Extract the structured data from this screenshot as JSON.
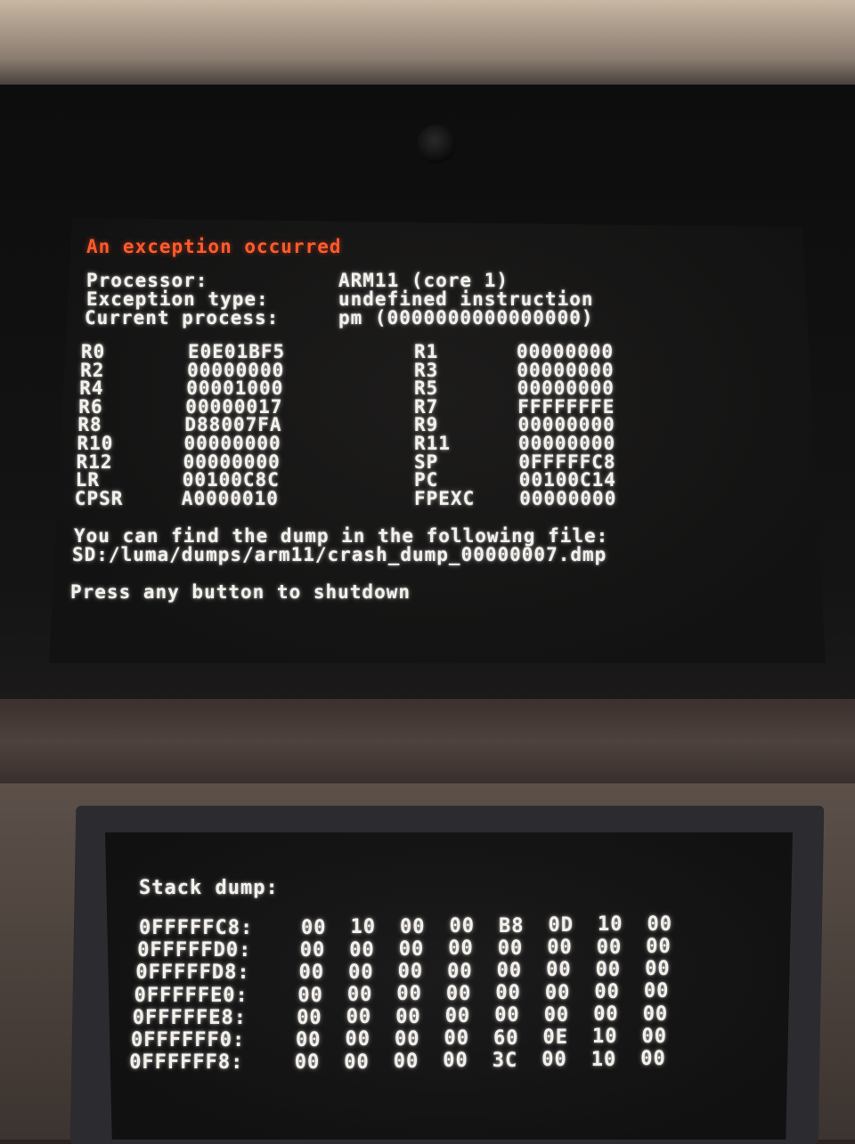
{
  "top_screen": {
    "title": "An exception occurred",
    "info": [
      {
        "label": "Processor:",
        "value": "ARM11 (core 1)"
      },
      {
        "label": "Exception type:",
        "value": "undefined instruction"
      },
      {
        "label": "Current process:",
        "value": "pm (0000000000000000)"
      }
    ],
    "registers_left": [
      {
        "name": "R0",
        "value": "E0E01BF5"
      },
      {
        "name": "R2",
        "value": "00000000"
      },
      {
        "name": "R4",
        "value": "00001000"
      },
      {
        "name": "R6",
        "value": "00000017"
      },
      {
        "name": "R8",
        "value": "D88007FA"
      },
      {
        "name": "R10",
        "value": "00000000"
      },
      {
        "name": "R12",
        "value": "00000000"
      },
      {
        "name": "LR",
        "value": "00100C8C"
      },
      {
        "name": "CPSR",
        "value": "A0000010"
      }
    ],
    "registers_right": [
      {
        "name": "R1",
        "value": "00000000"
      },
      {
        "name": "R3",
        "value": "00000000"
      },
      {
        "name": "R5",
        "value": "00000000"
      },
      {
        "name": "R7",
        "value": "FFFFFFFE"
      },
      {
        "name": "R9",
        "value": "00000000"
      },
      {
        "name": "R11",
        "value": "00000000"
      },
      {
        "name": "SP",
        "value": "0FFFFFC8"
      },
      {
        "name": "PC",
        "value": "00100C14"
      },
      {
        "name": "FPEXC",
        "value": "00000000"
      }
    ],
    "dump_msg": "You can find the dump in the following file:",
    "dump_path": "SD:/luma/dumps/arm11/crash_dump_00000007.dmp",
    "shutdown_msg": "Press any button to shutdown"
  },
  "bottom_screen": {
    "title": "Stack dump:",
    "rows": [
      {
        "addr": "0FFFFFC8:",
        "bytes": [
          "00",
          "10",
          "00",
          "00",
          "B8",
          "0D",
          "10",
          "00"
        ]
      },
      {
        "addr": "0FFFFFD0:",
        "bytes": [
          "00",
          "00",
          "00",
          "00",
          "00",
          "00",
          "00",
          "00"
        ]
      },
      {
        "addr": "0FFFFFD8:",
        "bytes": [
          "00",
          "00",
          "00",
          "00",
          "00",
          "00",
          "00",
          "00"
        ]
      },
      {
        "addr": "0FFFFFE0:",
        "bytes": [
          "00",
          "00",
          "00",
          "00",
          "00",
          "00",
          "00",
          "00"
        ]
      },
      {
        "addr": "0FFFFFE8:",
        "bytes": [
          "00",
          "00",
          "00",
          "00",
          "00",
          "00",
          "00",
          "00"
        ]
      },
      {
        "addr": "0FFFFFF0:",
        "bytes": [
          "00",
          "00",
          "00",
          "00",
          "60",
          "0E",
          "10",
          "00"
        ]
      },
      {
        "addr": "0FFFFFF8:",
        "bytes": [
          "00",
          "00",
          "00",
          "00",
          "3C",
          "00",
          "10",
          "00"
        ]
      }
    ]
  }
}
